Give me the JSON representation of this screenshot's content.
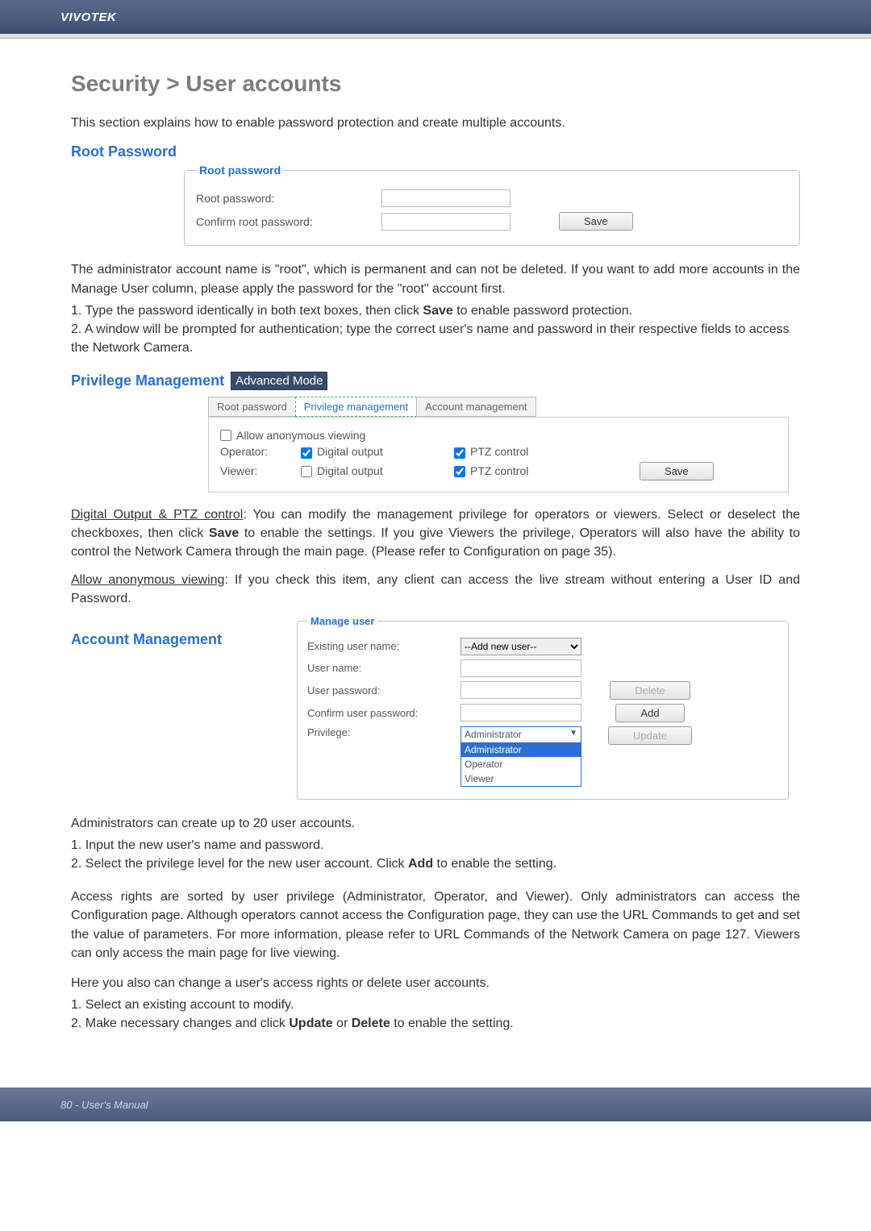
{
  "brand": "VIVOTEK",
  "page_title": "Security > User accounts",
  "intro": "This section explains how to enable password protection and create multiple accounts.",
  "root_section": {
    "heading": "Root Password",
    "legend": "Root password",
    "labels": {
      "pw": "Root password:",
      "confirm": "Confirm root password:"
    },
    "save": "Save"
  },
  "root_desc": {
    "p1": "The administrator account name is \"root\", which is permanent and can not be deleted. If you want to add more accounts in the Manage User column, please apply the password for the \"root\" account first.",
    "li1_a": "1. Type the password identically in both text boxes, then click ",
    "li1_b": "Save",
    "li1_c": " to enable password protection.",
    "li2": "2. A window will be prompted for authentication; type the correct user's name and password in their respective fields to access the Network Camera."
  },
  "priv_section": {
    "heading": "Privilege Management",
    "badge": "Advanced Mode",
    "tabs": [
      "Root password",
      "Privilege management",
      "Account management"
    ],
    "allow_anon": "Allow anonymous viewing",
    "rows": {
      "operator": "Operator:",
      "viewer": "Viewer:",
      "digital_output": "Digital output",
      "ptz_control": "PTZ control"
    },
    "save": "Save"
  },
  "priv_desc": {
    "under1": "Digital Output & PTZ control",
    "p1_a": ": You can modify the management privilege for operators or viewers. Select or deselect the checkboxes, then click ",
    "p1_b": "Save",
    "p1_c": " to enable the settings. If you give Viewers the privilege, Operators will also have the ability to control the Network Camera through the main page. (Please refer to Configuration on page 35).",
    "under2": "Allow anonymous viewing",
    "p2": ": If you check this item, any client can access the live stream without entering a User ID and Password."
  },
  "acct_section": {
    "heading": "Account Management",
    "legend": "Manage user",
    "labels": {
      "existing": "Existing user name:",
      "uname": "User name:",
      "upw": "User password:",
      "confirm": "Confirm user password:",
      "privilege": "Privilege:"
    },
    "existing_sel": "--Add new user--",
    "priv_options": [
      "Administrator",
      "Administrator",
      "Operator",
      "Viewer"
    ],
    "buttons": {
      "delete": "Delete",
      "add": "Add",
      "update": "Update"
    }
  },
  "acct_desc": {
    "p1": "Administrators can create up to 20 user accounts.",
    "li1": "1. Input the new user's name and password.",
    "li2_a": "2. Select the privilege level for the new user account. Click ",
    "li2_b": "Add",
    "li2_c": " to enable the setting.",
    "p2": "Access rights are sorted by user privilege (Administrator, Operator, and Viewer). Only administrators can access the Configuration page. Although operators cannot access the Configuration page, they can use the URL Commands to get and set the value of parameters. For more information, please refer to URL Commands of the Network Camera on page 127. Viewers can only access the main page for live viewing.",
    "p3": "Here you also can change a user's access rights or delete user accounts.",
    "li3": "1. Select an existing account to modify.",
    "li4_a": "2. Make necessary changes and click ",
    "li4_b": "Update",
    "li4_c": " or ",
    "li4_d": "Delete",
    "li4_e": " to enable the setting."
  },
  "footer": "80 - User's Manual"
}
